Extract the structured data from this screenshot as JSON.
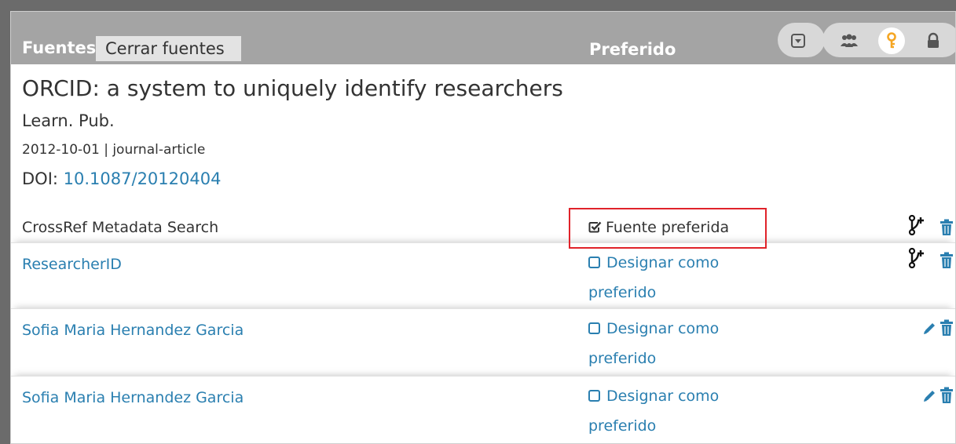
{
  "header": {
    "sources_label": "Fuentes",
    "close_sources_label": "Cerrar fuentes",
    "preferred_label": "Preferido",
    "icons": [
      "show-more-icon",
      "trusted-parties-icon",
      "limited-visibility-icon",
      "private-lock-icon"
    ]
  },
  "work": {
    "title": "ORCID: a system to uniquely identify researchers",
    "journal": "Learn. Pub.",
    "meta": "2012-10-01 | journal-article",
    "doi_label": "DOI: ",
    "doi_value": "10.1087/20120404"
  },
  "sources": [
    {
      "name": "CrossRef Metadata Search",
      "preferred_text": "Fuente preferida",
      "is_preferred": true,
      "actions": [
        "branch-icon",
        "trash-icon"
      ]
    },
    {
      "name": "ResearcherID",
      "preferred_text": "Designar como preferido",
      "is_preferred": false,
      "actions": [
        "branch-icon",
        "trash-icon"
      ]
    },
    {
      "name": "Sofia Maria Hernandez Garcia",
      "preferred_text": "Designar como preferido",
      "is_preferred": false,
      "actions": [
        "pencil-icon",
        "trash-icon"
      ]
    },
    {
      "name": "Sofia Maria Hernandez Garcia",
      "preferred_text": "Designar como preferido",
      "is_preferred": false,
      "actions": [
        "pencil-icon",
        "trash-icon"
      ]
    }
  ],
  "colors": {
    "header_bg": "#a4a4a4",
    "link": "#2a7fb0",
    "highlight_border": "#e0232a",
    "key_accent": "#f5a623"
  }
}
